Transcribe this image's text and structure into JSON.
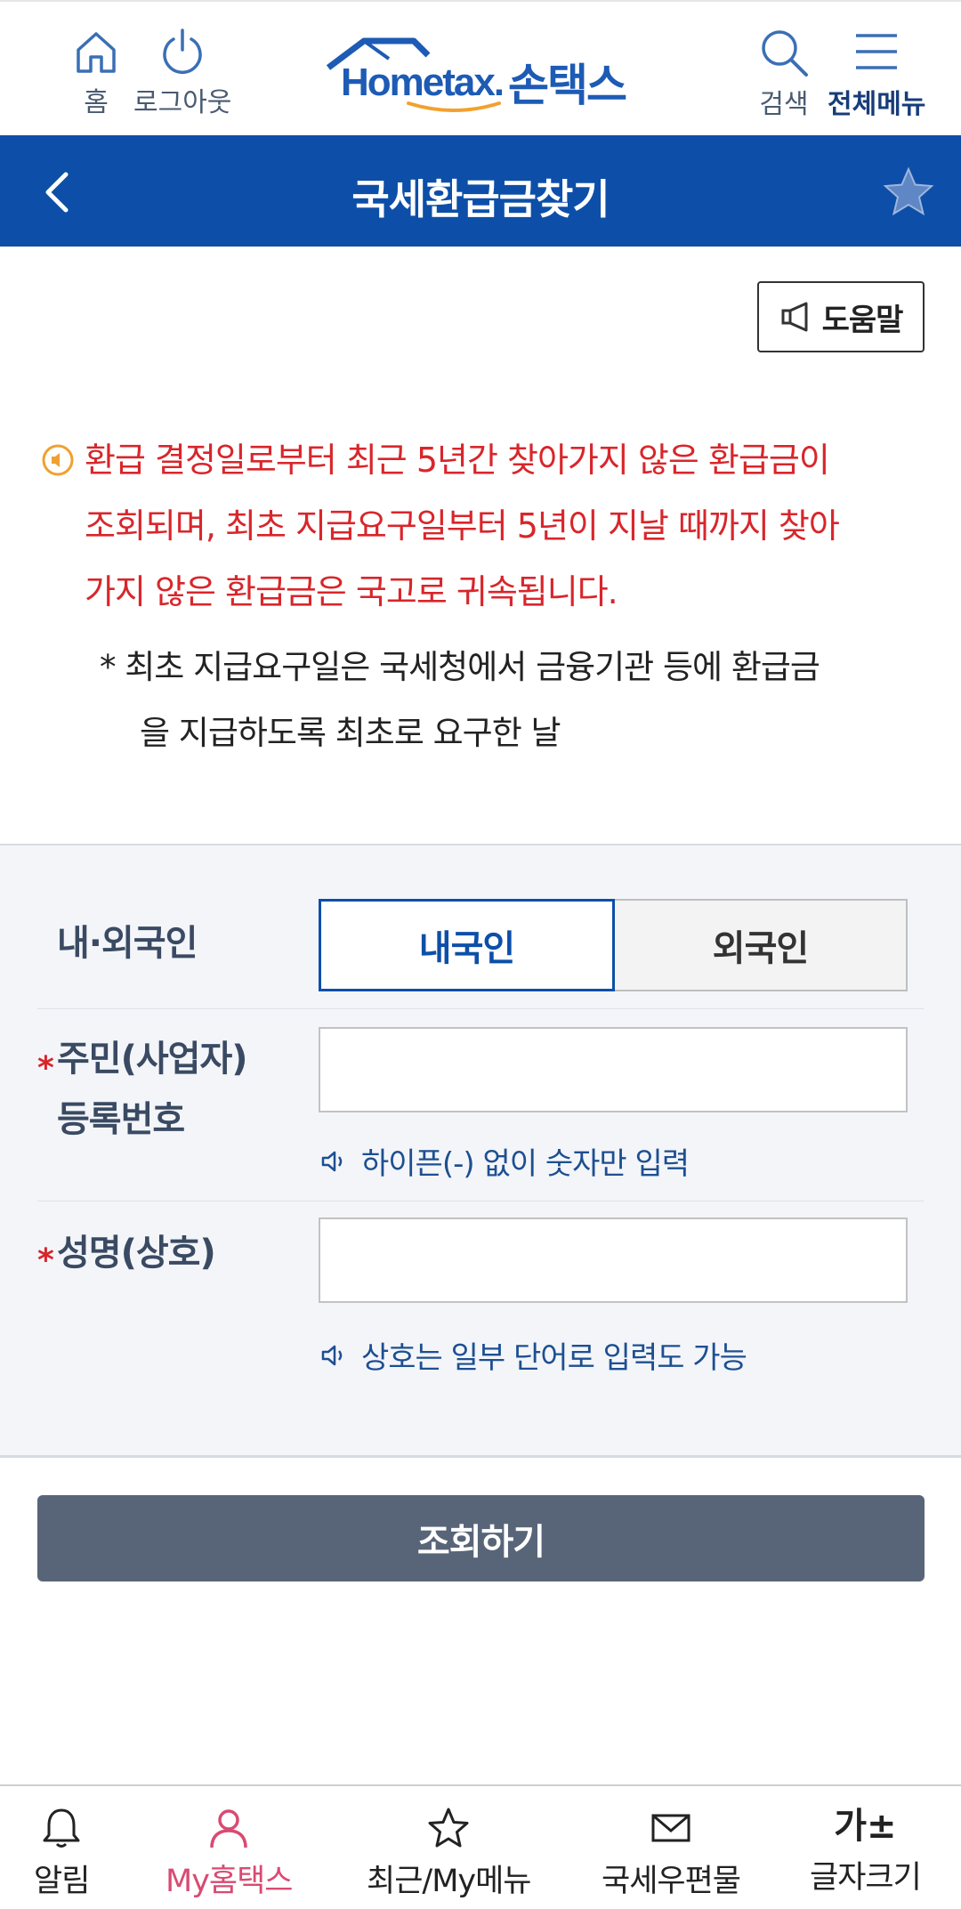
{
  "header": {
    "home_label": "홈",
    "logout_label": "로그아웃",
    "logo_text_latin": "Hometax.",
    "logo_text_korean": "손택스",
    "search_label": "검색",
    "all_menu_label": "전체메뉴"
  },
  "title_bar": {
    "title": "국세환급금찾기"
  },
  "help": {
    "label": "도움말"
  },
  "notice": {
    "red_lines": [
      "환급 결정일로부터 최근 5년간 찾아가지 않은 환급금이",
      "조회되며, 최초 지급요구일부터 5년이 지날 때까지 찾아",
      "가지 않은 환급금은 국고로 귀속됩니다."
    ],
    "sub_lines": [
      "* 최초 지급요구일은 국세청에서 금융기관 등에 환급금",
      "을 지급하도록 최초로 요구한 날"
    ]
  },
  "form": {
    "nationality": {
      "label": "내·외국인",
      "options": [
        "내국인",
        "외국인"
      ],
      "selected": "내국인"
    },
    "reg_number": {
      "required_mark": "*",
      "label_line1": "주민(사업자)",
      "label_line2": "등록번호",
      "value": "",
      "hint": "하이픈(-) 없이 숫자만 입력"
    },
    "name": {
      "required_mark": "*",
      "label": "성명(상호)",
      "value": "",
      "hint": "상호는 일부 단어로 입력도 가능"
    }
  },
  "submit": {
    "label": "조회하기"
  },
  "bottom_nav": {
    "items": [
      {
        "label": "알림",
        "icon": "bell-icon"
      },
      {
        "label": "My홈택스",
        "icon": "person-icon",
        "active": true
      },
      {
        "label": "최근/My메뉴",
        "icon": "star-icon"
      },
      {
        "label": "국세우편물",
        "icon": "mail-icon"
      },
      {
        "label": "글자크기",
        "icon": "font-size-icon",
        "glyph": "가±"
      }
    ]
  },
  "colors": {
    "brand_blue": "#0d4fa8",
    "notice_red": "#d8262b",
    "submit_gray": "#586579",
    "active_pink": "#d94a72"
  }
}
